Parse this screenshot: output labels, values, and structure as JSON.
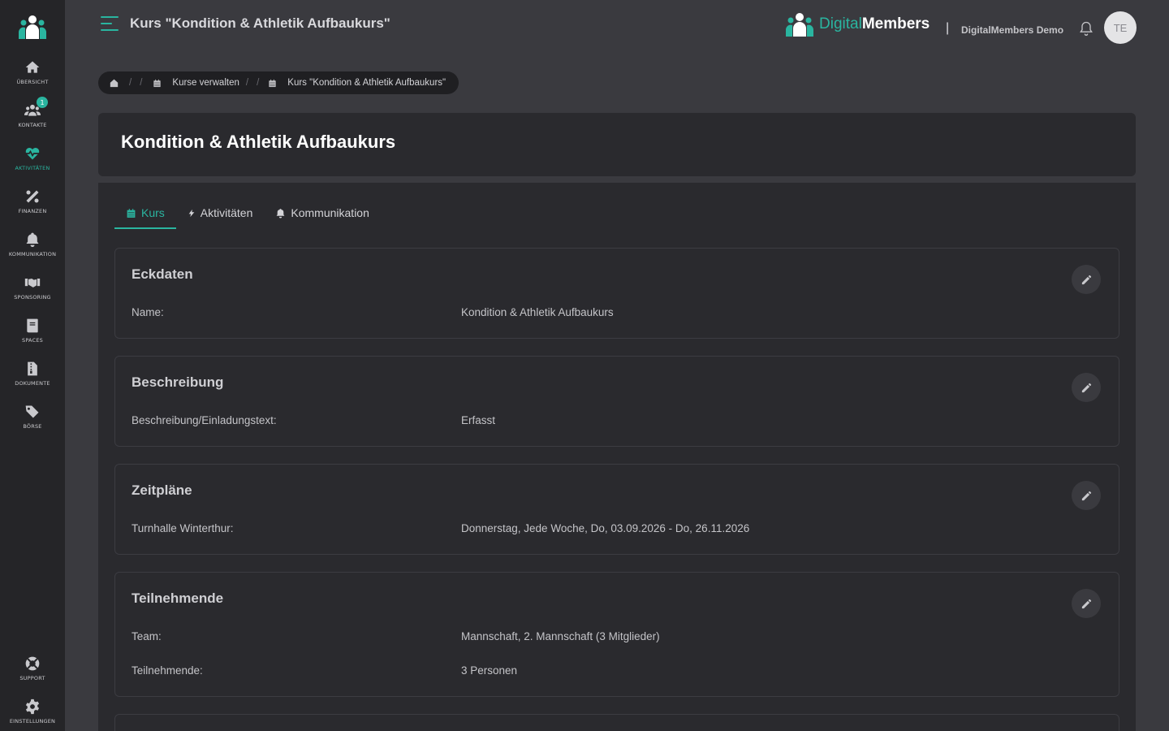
{
  "header": {
    "page_title": "Kurs \"Kondition & Athletik Aufbaukurs\"",
    "brand_light": "Digital",
    "brand_bold": "Members",
    "separator": "|",
    "org_name": "DigitalMembers Demo",
    "avatar_initials": "TE"
  },
  "sidebar": {
    "items": [
      {
        "label": "ÜBERSICHT",
        "icon": "home-icon"
      },
      {
        "label": "KONTAKTE",
        "icon": "users-icon",
        "badge": "1"
      },
      {
        "label": "AKTIVITÄTEN",
        "icon": "heartbeat-icon",
        "active": true
      },
      {
        "label": "FINANZEN",
        "icon": "percent-icon"
      },
      {
        "label": "KOMMUNIKATION",
        "icon": "bell-icon"
      },
      {
        "label": "SPONSORING",
        "icon": "handshake-icon"
      },
      {
        "label": "SPACES",
        "icon": "book-icon"
      },
      {
        "label": "DOKUMENTE",
        "icon": "file-zipper-icon"
      },
      {
        "label": "BÖRSE",
        "icon": "tags-icon"
      }
    ],
    "bottom_items": [
      {
        "label": "SUPPORT",
        "icon": "life-ring-icon"
      },
      {
        "label": "EINSTELLUNGEN",
        "icon": "gear-icon"
      }
    ]
  },
  "breadcrumb": {
    "separator": "/",
    "items": [
      {
        "label": "Kurse verwalten",
        "icon": "calendar-icon"
      },
      {
        "label": "Kurs \"Kondition & Athletik Aufbaukurs\"",
        "icon": "calendar-icon"
      }
    ]
  },
  "course": {
    "title": "Kondition & Athletik Aufbaukurs"
  },
  "tabs": [
    {
      "label": "Kurs",
      "icon": "calendar-icon",
      "active": true
    },
    {
      "label": "Aktivitäten",
      "icon": "bolt-icon"
    },
    {
      "label": "Kommunikation",
      "icon": "bell-icon"
    }
  ],
  "sections": {
    "eckdaten": {
      "title": "Eckdaten",
      "rows": [
        {
          "label": "Name:",
          "value": "Kondition & Athletik Aufbaukurs"
        }
      ]
    },
    "beschreibung": {
      "title": "Beschreibung",
      "rows": [
        {
          "label": "Beschreibung/Einladungstext:",
          "value": "Erfasst"
        }
      ]
    },
    "zeitplaene": {
      "title": "Zeitpläne",
      "rows": [
        {
          "label": "Turnhalle Winterthur:",
          "value": "Donnerstag, Jede Woche, Do, 03.09.2026 - Do, 26.11.2026"
        }
      ]
    },
    "teilnehmende": {
      "title": "Teilnehmende",
      "rows": [
        {
          "label": "Team:",
          "value": "Mannschaft, 2. Mannschaft (3 Mitglieder)"
        },
        {
          "label": "Teilnehmende:",
          "value": "3 Personen"
        }
      ]
    }
  },
  "colors": {
    "accent": "#2ab5a0",
    "sidebar_bg": "#252528",
    "page_bg": "#3a3a3f",
    "card_bg": "#2a2a2e"
  }
}
